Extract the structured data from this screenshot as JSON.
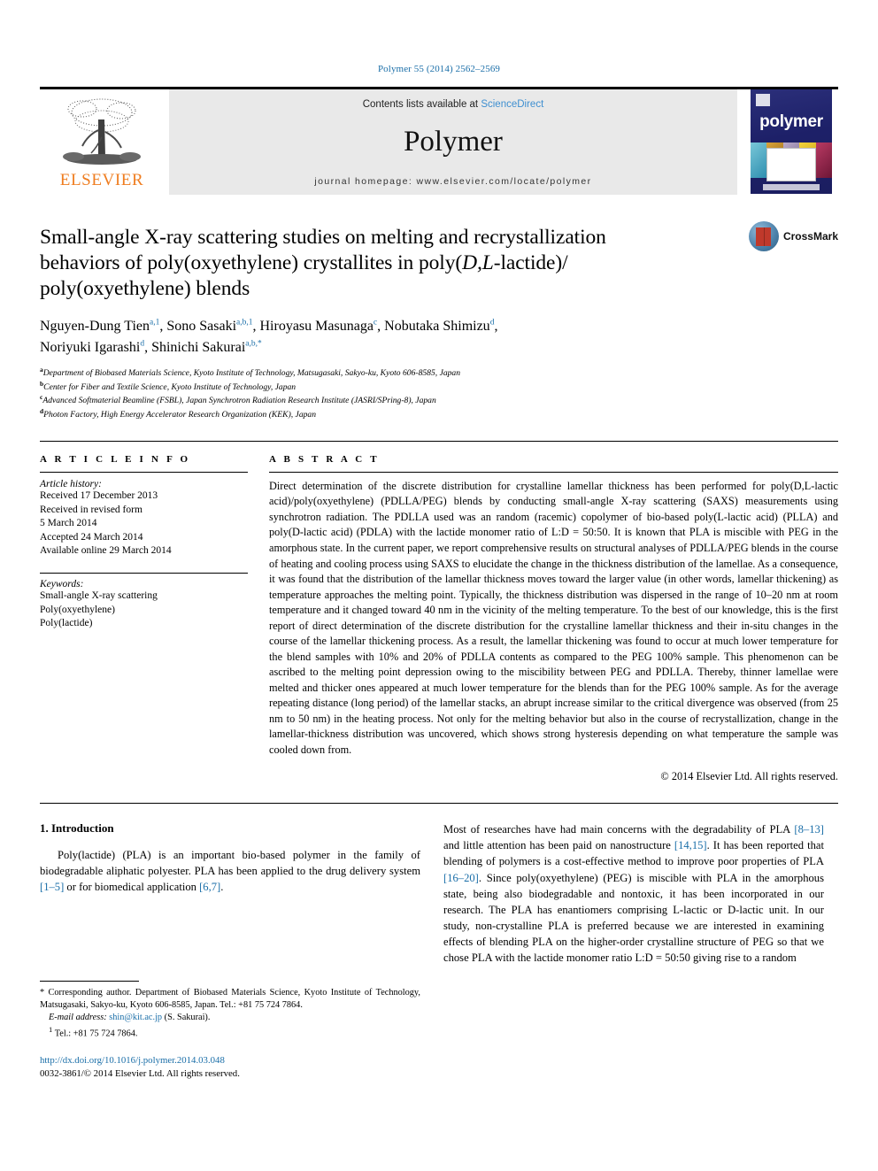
{
  "running_head": "Polymer 55 (2014) 2562–2569",
  "header": {
    "contents_prefix": "Contents lists available at ",
    "sciencedirect": "ScienceDirect",
    "journal_name": "Polymer",
    "homepage": "journal homepage: www.elsevier.com/locate/polymer",
    "publisher_wordmark": "ELSEVIER",
    "cover_title": "polymer",
    "accent_blue": "#3e8fd0",
    "elsevier_orange": "#ef7d20",
    "link_blue": "#1a6ea8"
  },
  "article": {
    "title_line1": "Small-angle X-ray scattering studies on melting and recrystallization",
    "title_line2_a": "behaviors of poly(oxyethylene) crystallites in poly(",
    "title_line2_sc": "D,L",
    "title_line2_b": "-lactide)/",
    "title_line3": "poly(oxyethylene) blends",
    "crossmark_label": "CrossMark",
    "authors_line1": "Nguyen-Dung Tien a,1, Sono Sasaki a,b,1, Hiroyasu Masunaga c, Nobutaka Shimizu d,",
    "authors_line2": "Noriyuki Igarashi d, Shinichi Sakurai a,b,*",
    "authors": [
      {
        "name": "Nguyen-Dung Tien",
        "sup": "a,1",
        "sep": ", "
      },
      {
        "name": "Sono Sasaki",
        "sup": "a,b,1",
        "sep": ", "
      },
      {
        "name": "Hiroyasu Masunaga",
        "sup": "c",
        "sep": ", "
      },
      {
        "name": "Nobutaka Shimizu",
        "sup": "d",
        "sep": ", "
      },
      {
        "name": "Noriyuki Igarashi",
        "sup": "d",
        "sep": ", "
      },
      {
        "name": "Shinichi Sakurai",
        "sup": "a,b,*",
        "sep": ""
      }
    ],
    "affiliations": [
      {
        "mark": "a",
        "text": "Department of Biobased Materials Science, Kyoto Institute of Technology, Matsugasaki, Sakyo-ku, Kyoto 606-8585, Japan"
      },
      {
        "mark": "b",
        "text": "Center for Fiber and Textile Science, Kyoto Institute of Technology, Japan"
      },
      {
        "mark": "c",
        "text": "Advanced Softmaterial Beamline (FSBL), Japan Synchrotron Radiation Research Institute (JASRI/SPring-8), Japan"
      },
      {
        "mark": "d",
        "text": "Photon Factory, High Energy Accelerator Research Organization (KEK), Japan"
      }
    ]
  },
  "article_info": {
    "heading": "A R T I C L E  I N F O",
    "history_label": "Article history:",
    "history": [
      "Received 17 December 2013",
      "Received in revised form",
      "5 March 2014",
      "Accepted 24 March 2014",
      "Available online 29 March 2014"
    ],
    "keywords_label": "Keywords:",
    "keywords": [
      "Small-angle X-ray scattering",
      "Poly(oxyethylene)",
      "Poly(lactide)"
    ]
  },
  "abstract": {
    "heading": "A B S T R A C T",
    "text": "Direct determination of the discrete distribution for crystalline lamellar thickness has been performed for poly(D,L-lactic acid)/poly(oxyethylene) (PDLLA/PEG) blends by conducting small-angle X-ray scattering (SAXS) measurements using synchrotron radiation. The PDLLA used was an random (racemic) copolymer of bio-based poly(L-lactic acid) (PLLA) and poly(D-lactic acid) (PDLA) with the lactide monomer ratio of L:D = 50:50. It is known that PLA is miscible with PEG in the amorphous state. In the current paper, we report comprehensive results on structural analyses of PDLLA/PEG blends in the course of heating and cooling process using SAXS to elucidate the change in the thickness distribution of the lamellae. As a consequence, it was found that the distribution of the lamellar thickness moves toward the larger value (in other words, lamellar thickening) as temperature approaches the melting point. Typically, the thickness distribution was dispersed in the range of 10–20 nm at room temperature and it changed toward 40 nm in the vicinity of the melting temperature. To the best of our knowledge, this is the first report of direct determination of the discrete distribution for the crystalline lamellar thickness and their in-situ changes in the course of the lamellar thickening process. As a result, the lamellar thickening was found to occur at much lower temperature for the blend samples with 10% and 20% of PDLLA contents as compared to the PEG 100% sample. This phenomenon can be ascribed to the melting point depression owing to the miscibility between PEG and PDLLA. Thereby, thinner lamellae were melted and thicker ones appeared at much lower temperature for the blends than for the PEG 100% sample. As for the average repeating distance (long period) of the lamellar stacks, an abrupt increase similar to the critical divergence was observed (from 25 nm to 50 nm) in the heating process. Not only for the melting behavior but also in the course of recrystallization, change in the lamellar-thickness distribution was uncovered, which shows strong hysteresis depending on what temperature the sample was cooled down from.",
    "copyright": "© 2014 Elsevier Ltd. All rights reserved."
  },
  "introduction": {
    "heading": "1. Introduction",
    "left_paragraph_a": "Poly(lactide) (PLA) is an important bio-based polymer in the family of biodegradable aliphatic polyester. PLA has been applied to the drug delivery system ",
    "left_cite_1": "[1–5]",
    "left_paragraph_b": " or for biomedical application ",
    "left_cite_2": "[6,7]",
    "left_paragraph_c": ".",
    "right_a": "Most of researches have had main concerns with the degradability of PLA ",
    "right_cite_1": "[8–13]",
    "right_b": " and little attention has been paid on nanostructure ",
    "right_cite_2": "[14,15]",
    "right_c": ". It has been reported that blending of polymers is a cost-effective method to improve poor properties of PLA ",
    "right_cite_3": "[16–20]",
    "right_d": ". Since poly(oxyethylene) (PEG) is miscible with PLA in the amorphous state, being also biodegradable and nontoxic, it has been incorporated in our research. The PLA has enantiomers comprising L-lactic or D-lactic unit. In our study, non-crystalline PLA is preferred because we are interested in examining effects of blending PLA on the higher-order crystalline structure of PEG so that we chose PLA with the lactide monomer ratio L:D = 50:50 giving rise to a random"
  },
  "footnotes": {
    "corresponding": "* Corresponding author. Department of Biobased Materials Science, Kyoto Institute of Technology, Matsugasaki, Sakyo-ku, Kyoto 606-8585, Japan. Tel.: +81 75 724 7864.",
    "email_label": "E-mail address:",
    "email": "shin@kit.ac.jp",
    "email_owner": "(S. Sakurai).",
    "tel_mark": "1",
    "tel": "Tel.: +81 75 724 7864.",
    "doi": "http://dx.doi.org/10.1016/j.polymer.2014.03.048",
    "issn": "0032-3861/© 2014 Elsevier Ltd. All rights reserved."
  }
}
